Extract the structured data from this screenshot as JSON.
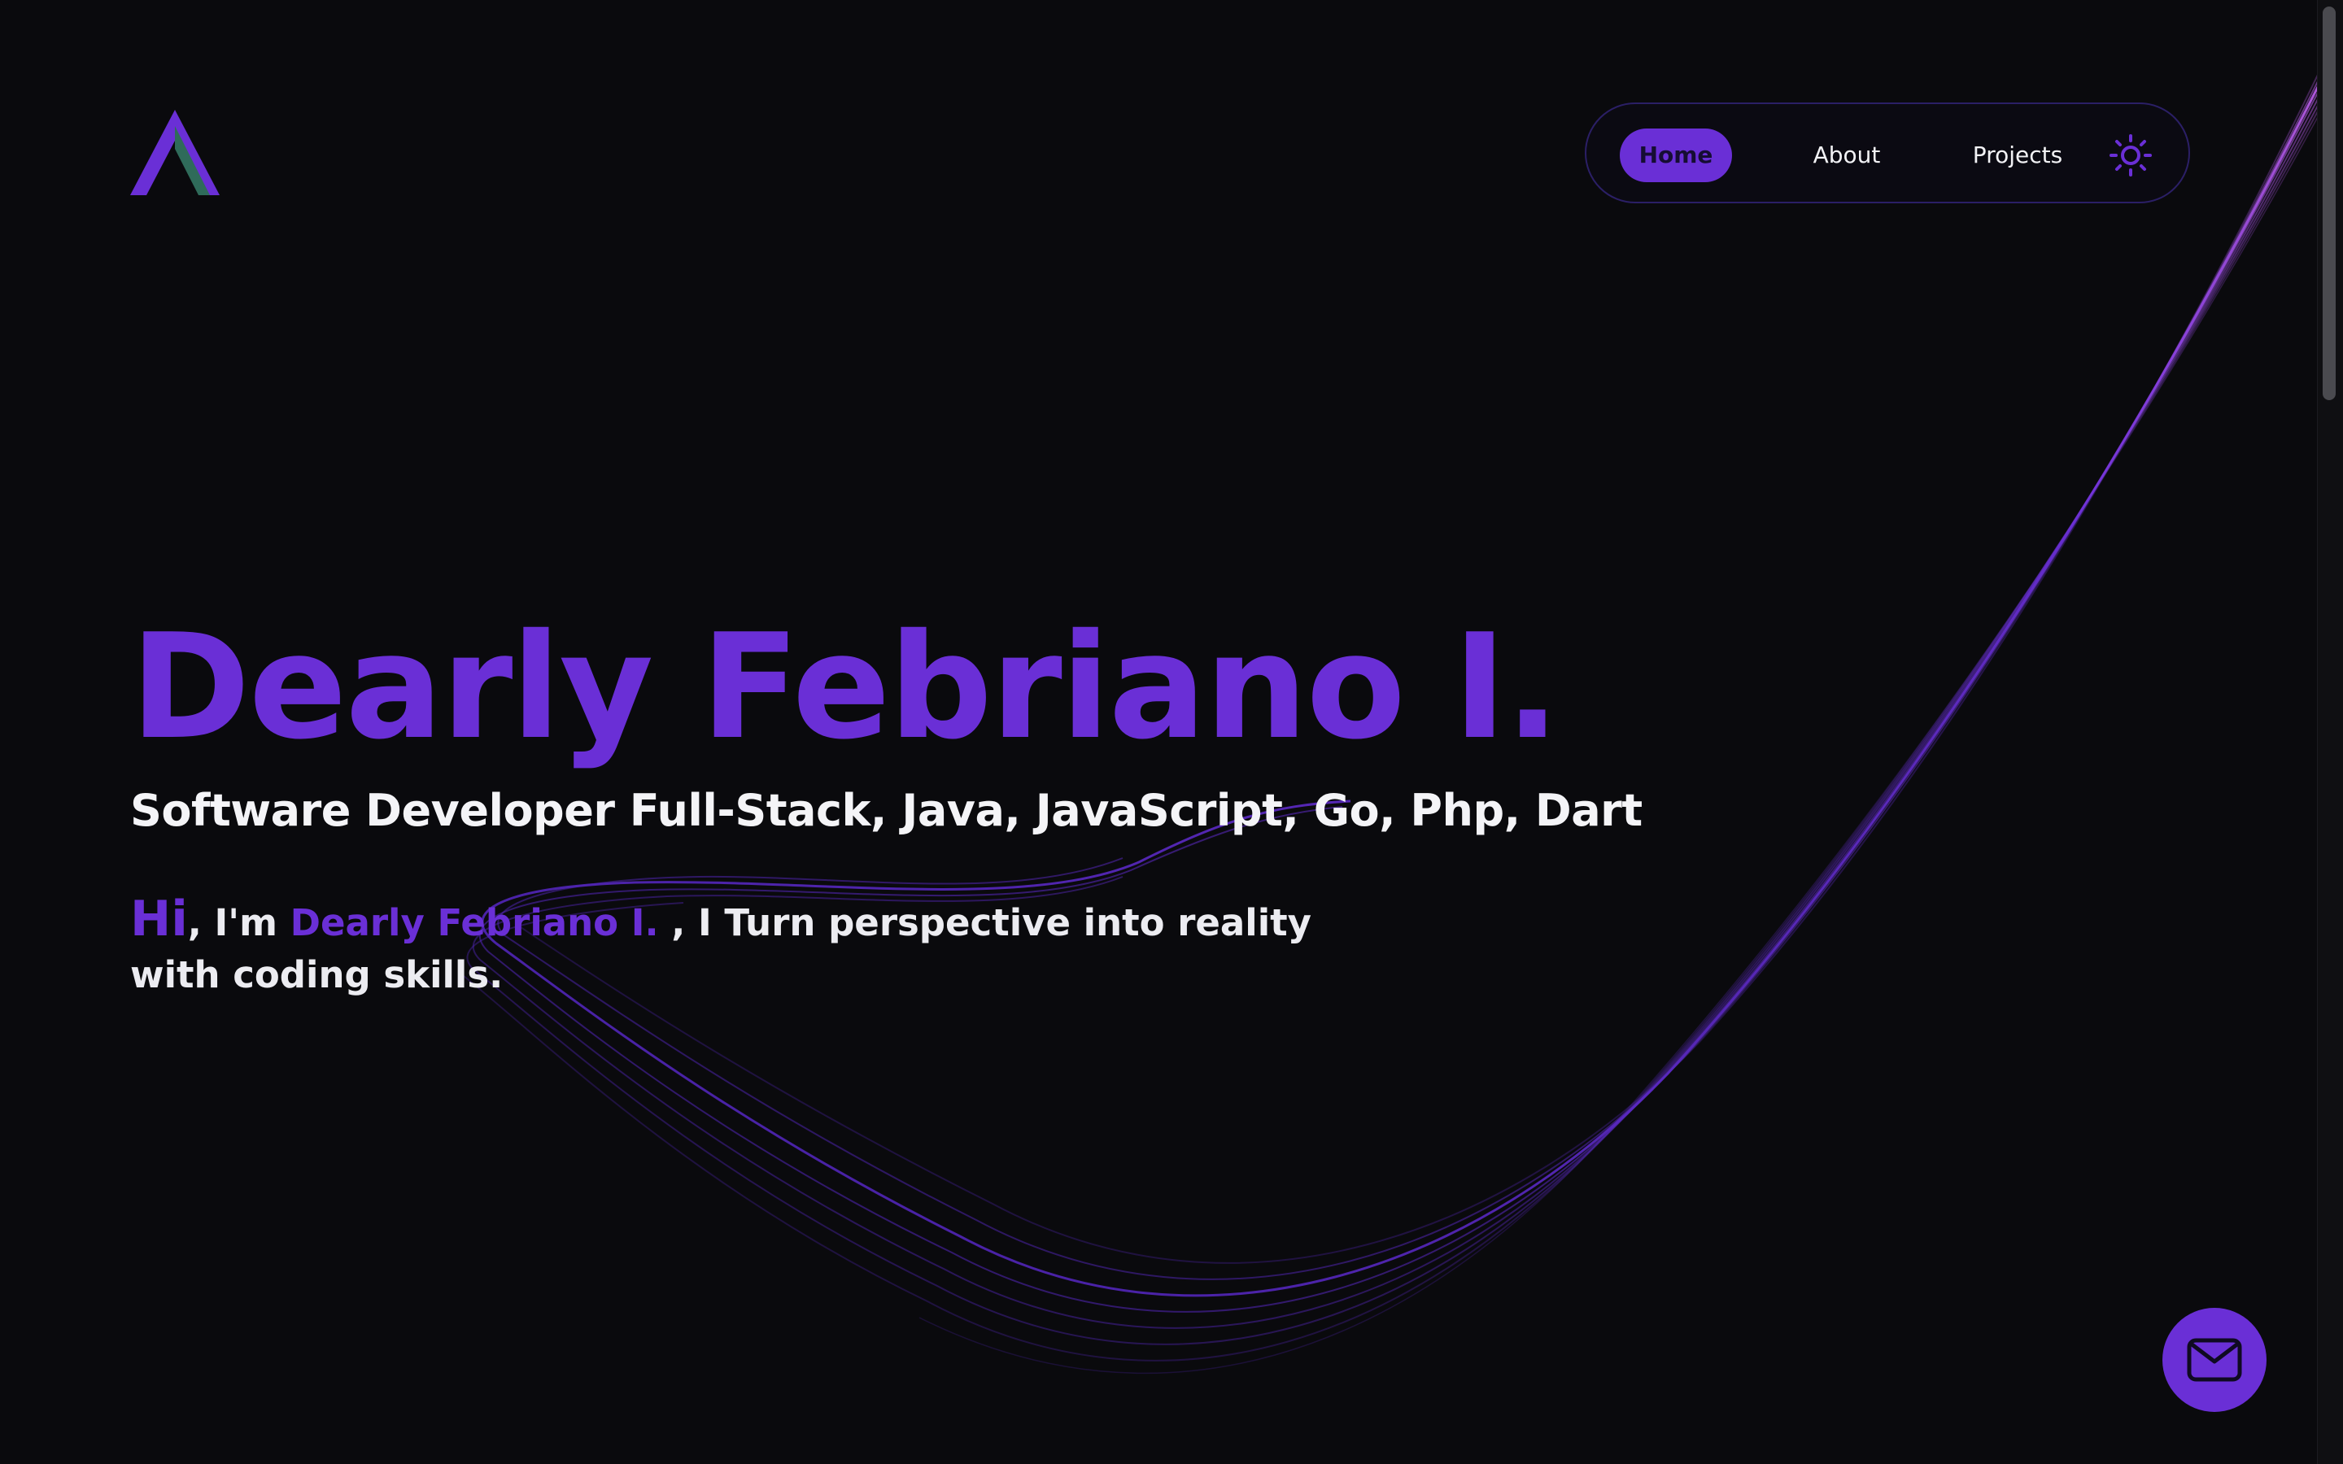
{
  "nav": {
    "items": [
      {
        "label": "Home",
        "active": true
      },
      {
        "label": "About",
        "active": false
      },
      {
        "label": "Projects",
        "active": false
      }
    ],
    "theme_icon": "sun-icon"
  },
  "hero": {
    "name": "Dearly Febriano I.",
    "role": "Software Developer Full-Stack, Java, JavaScript, Go, Php, Dart",
    "intro": {
      "hi": "Hi",
      "im": ", I'm ",
      "name": "Dearly Febriano I.",
      "rest": " , I Turn perspective into reality with coding skills."
    }
  },
  "mail_icon": "mail-icon",
  "logo_icon": "logo-icon",
  "colors": {
    "background": "#0a0a0d",
    "accent": "#6a2fd6",
    "text": "#f2f2f5",
    "logo_green": "#2f6b5a"
  }
}
